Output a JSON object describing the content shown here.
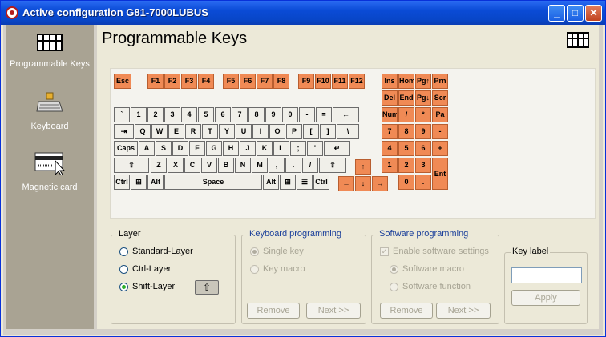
{
  "window": {
    "title": "Active configuration G81-7000LUBUS",
    "minimize_glyph": "_",
    "maximize_glyph": "□",
    "close_glyph": "✕"
  },
  "sidebar": {
    "items": [
      {
        "label": "Programmable Keys",
        "icon": "keyboard-grid-icon"
      },
      {
        "label": "Keyboard",
        "icon": "keyboard-icon"
      },
      {
        "label": "Magnetic card",
        "icon": "magnetic-card-icon"
      }
    ]
  },
  "page": {
    "title": "Programmable Keys",
    "title_icon": "keyboard-grid-icon"
  },
  "keyboard": {
    "function_row": [
      "Esc",
      "F1",
      "F2",
      "F3",
      "F4",
      "F5",
      "F6",
      "F7",
      "F8",
      "F9",
      "F10",
      "F11",
      "F12"
    ],
    "row1": [
      "`",
      "1",
      "2",
      "3",
      "4",
      "5",
      "6",
      "7",
      "8",
      "9",
      "0",
      "-",
      "=",
      "←"
    ],
    "row2": [
      "⇥",
      "Q",
      "W",
      "E",
      "R",
      "T",
      "Y",
      "U",
      "I",
      "O",
      "P",
      "[",
      "]",
      "\\"
    ],
    "row3": [
      "Caps",
      "A",
      "S",
      "D",
      "F",
      "G",
      "H",
      "J",
      "K",
      "L",
      ";",
      "'",
      "↵"
    ],
    "row4": [
      "⇧",
      "Z",
      "X",
      "C",
      "V",
      "B",
      "N",
      "M",
      ",",
      ".",
      "/",
      "⇧"
    ],
    "row5": [
      "Ctrl",
      "⊞",
      "Alt",
      "Space",
      "Alt",
      "⊞",
      "☰",
      "Ctrl"
    ],
    "nav_keys": [
      "Ins",
      "Hom",
      "Pg↑",
      "Prn",
      "Del",
      "End",
      "Pg↓",
      "Scr"
    ],
    "numpad": [
      "Num",
      "/",
      "*",
      "Pa",
      "7",
      "8",
      "9",
      "-",
      "4",
      "5",
      "6",
      "+",
      "1",
      "2",
      "3",
      "Ent",
      "0",
      "."
    ],
    "arrows": [
      "↑",
      "←",
      "↓",
      "→"
    ]
  },
  "layer": {
    "title": "Layer",
    "options": [
      "Standard-Layer",
      "Ctrl-Layer",
      "Shift-Layer"
    ],
    "selected": "Shift-Layer",
    "shift_indicator": "⇧"
  },
  "keyboard_programming": {
    "title": "Keyboard programming",
    "options": [
      "Single key",
      "Key macro"
    ],
    "remove_label": "Remove",
    "next_label": "Next >>"
  },
  "software_programming": {
    "title": "Software programming",
    "enable_label": "Enable software settings",
    "options": [
      "Software macro",
      "Software function"
    ],
    "remove_label": "Remove",
    "next_label": "Next >>"
  },
  "key_label": {
    "title": "Key label",
    "value": "",
    "apply_label": "Apply"
  },
  "colors": {
    "programmed_key": "#f08a55",
    "title_bar": "#0a4bd6",
    "sidebar": "#a9a393"
  }
}
